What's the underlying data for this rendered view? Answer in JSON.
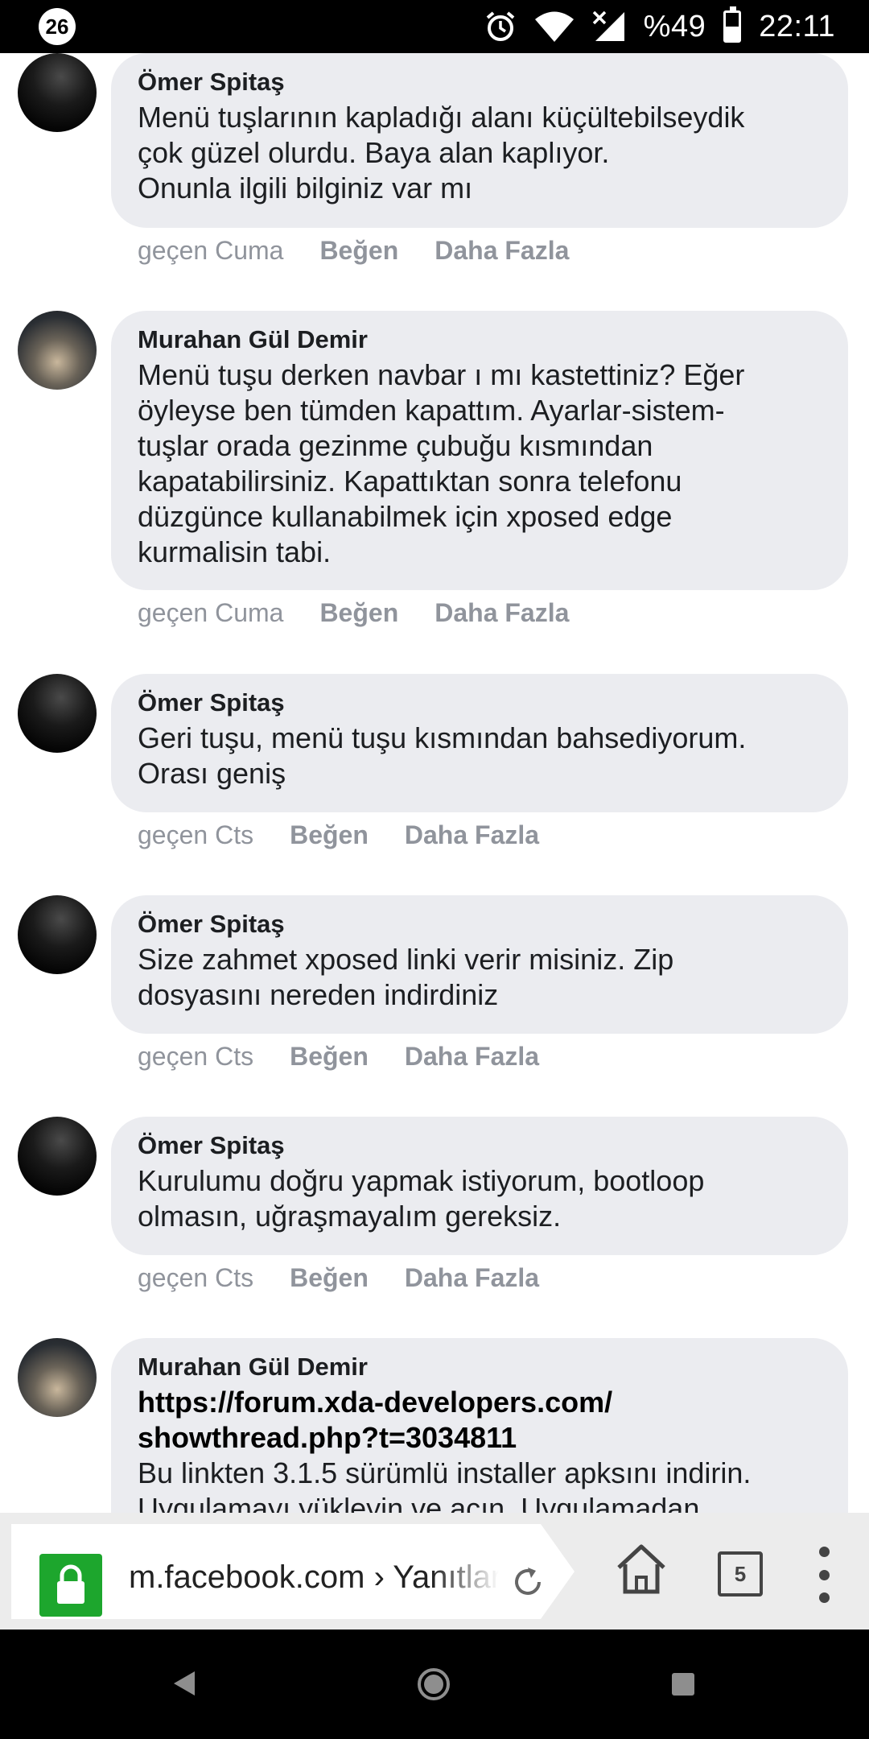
{
  "status_bar": {
    "notification_badge": "26",
    "battery_text": "%49",
    "battery_level": 0.49,
    "time": "22:11"
  },
  "comments": [
    {
      "author": "Ömer Spitaş",
      "text": "Menü tuşlarının kapladığı alanı küçültebilseydik\nçok güzel olurdu. Baya alan kaplıyor.\nOnunla ilgili bilginiz var mı",
      "time": "geçen Cuma",
      "like": "Beğen",
      "more": "Daha Fazla"
    },
    {
      "author": "Murahan Gül Demir",
      "text": "Menü tuşu derken navbar ı mı kastettiniz? Eğer\nöyleyse ben tümden kapattım. Ayarlar-sistem-\ntuşlar orada gezinme çubuğu kısmından\nkapatabilirsiniz. Kapattıktan sonra telefonu\ndüzgünce kullanabilmek için xposed edge\nkurmalisin tabi.",
      "time": "geçen Cuma",
      "like": "Beğen",
      "more": "Daha Fazla"
    },
    {
      "author": "Ömer Spitaş",
      "text": "Geri tuşu, menü tuşu kısmından bahsediyorum.\nOrası geniş",
      "time": "geçen Cts",
      "like": "Beğen",
      "more": "Daha Fazla"
    },
    {
      "author": "Ömer Spitaş",
      "text": "Size zahmet xposed linki verir misiniz. Zip\ndosyasını nereden indirdiniz",
      "time": "geçen Cts",
      "like": "Beğen",
      "more": "Daha Fazla"
    },
    {
      "author": "Ömer Spitaş",
      "text": "Kurulumu doğru yapmak istiyorum, bootloop\nolmasın, uğraşmayalım gereksiz.",
      "time": "geçen Cts",
      "like": "Beğen",
      "more": "Daha Fazla"
    },
    {
      "author": "Murahan Gül Demir",
      "link": "https://forum.xda-developers.com/\nshowthread.php?t=3034811",
      "text": "Bu linkten 3.1.5 sürümlü installer apksını indirin.\nUygulamayı yükleyin ve açın. Uygulamadan"
    }
  ],
  "browser": {
    "url": "m.facebook.com › Yanıtlar",
    "tab_count": "5"
  }
}
